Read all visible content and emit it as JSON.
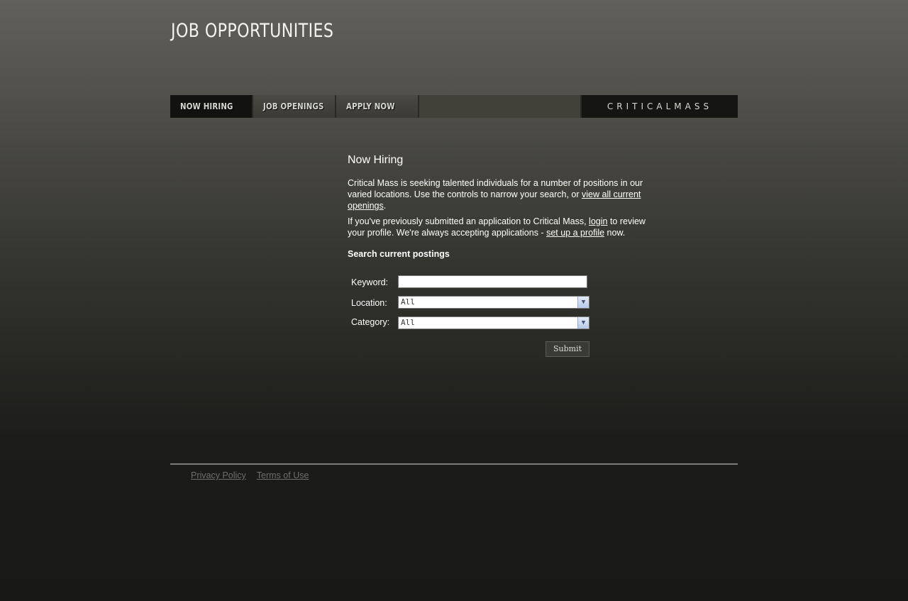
{
  "header": {
    "title": "JOB OPPORTUNITIES"
  },
  "nav": {
    "tabs": [
      {
        "label": "NOW HIRING",
        "active": true
      },
      {
        "label": "JOB OPENINGS",
        "active": false
      },
      {
        "label": "APPLY NOW",
        "active": false
      }
    ],
    "brand": "CRITICALMASS"
  },
  "main": {
    "heading": "Now Hiring",
    "intro": {
      "text_before": "Critical Mass is seeking talented individuals for a number of positions in our varied locations. Use the controls to narrow your search, or ",
      "link": "view all current openings",
      "text_after": "."
    },
    "returning": {
      "text_before": "If you've previously submitted an application to Critical Mass, ",
      "login_link": "login",
      "text_middle": " to review your profile. We're always accepting applications - ",
      "profile_link": "set up a profile",
      "text_after": " now."
    },
    "search_heading": "Search current postings",
    "form": {
      "keyword_label": "Keyword:",
      "keyword_value": "",
      "location_label": "Location:",
      "location_value": "All",
      "category_label": "Category:",
      "category_value": "All",
      "submit_label": "Submit"
    }
  },
  "footer": {
    "links": [
      "Privacy Policy",
      "Terms of Use"
    ]
  },
  "colors": {
    "background_top": "#62605a",
    "background_bottom": "#181816",
    "nav_active": "#121210",
    "footer_text": "#6e6e6a"
  }
}
